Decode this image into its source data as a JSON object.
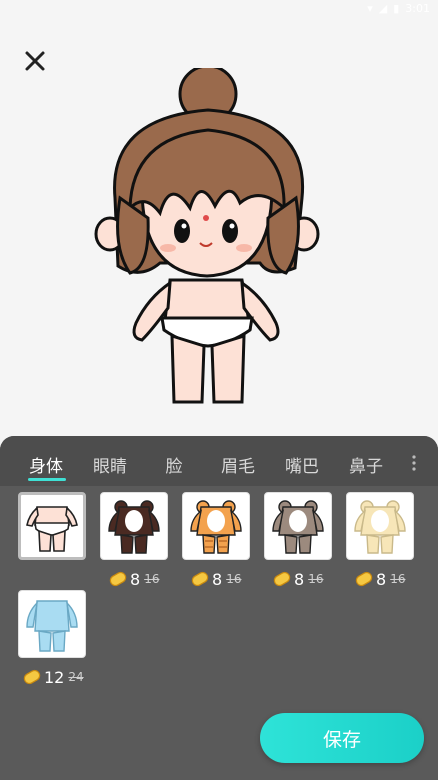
{
  "status_bar": {
    "time": "3:01"
  },
  "tabs": [
    {
      "label": "身体",
      "active": true
    },
    {
      "label": "眼睛",
      "active": false
    },
    {
      "label": "脸",
      "active": false
    },
    {
      "label": "眉毛",
      "active": false
    },
    {
      "label": "嘴巴",
      "active": false
    },
    {
      "label": "鼻子",
      "active": false
    }
  ],
  "items": [
    {
      "name": "body-default",
      "selected": true,
      "price": null,
      "original_price": null,
      "color": "#fde1d6"
    },
    {
      "name": "body-brown-bear",
      "selected": false,
      "price": "8",
      "original_price": "16",
      "color": "#4a2a22"
    },
    {
      "name": "body-orange-tiger",
      "selected": false,
      "price": "8",
      "original_price": "16",
      "color": "#f3a24e"
    },
    {
      "name": "body-grey-bear",
      "selected": false,
      "price": "8",
      "original_price": "16",
      "color": "#9c8a7e"
    },
    {
      "name": "body-cream",
      "selected": false,
      "price": "8",
      "original_price": "16",
      "color": "#f7e6b8"
    },
    {
      "name": "body-light-blue",
      "selected": false,
      "price": "12",
      "original_price": "24",
      "color": "#a9dcf2"
    }
  ],
  "save_button": {
    "label": "保存"
  },
  "colors": {
    "accent": "#2ee3d8",
    "panel": "#5a5a5a",
    "tabbar": "#4d4d4d"
  }
}
